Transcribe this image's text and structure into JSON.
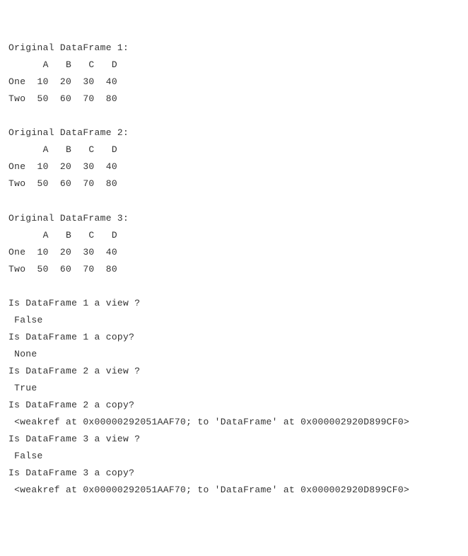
{
  "sections": [
    {
      "title": "Original DataFrame 1:",
      "header": "      A   B   C   D",
      "rows": [
        "One  10  20  30  40",
        "Two  50  60  70  80"
      ]
    },
    {
      "title": "Original DataFrame 2:",
      "header": "      A   B   C   D",
      "rows": [
        "One  10  20  30  40",
        "Two  50  60  70  80"
      ]
    },
    {
      "title": "Original DataFrame 3:",
      "header": "      A   B   C   D",
      "rows": [
        "One  10  20  30  40",
        "Two  50  60  70  80"
      ]
    }
  ],
  "qa": [
    {
      "q": "Is DataFrame 1 a view ?",
      "a": " False"
    },
    {
      "q": "Is DataFrame 1 a copy?",
      "a": " None"
    },
    {
      "q": "Is DataFrame 2 a view ?",
      "a": " True"
    },
    {
      "q": "Is DataFrame 2 a copy?",
      "a": " <weakref at 0x00000292051AAF70; to 'DataFrame' at 0x000002920D899CF0>"
    },
    {
      "q": "Is DataFrame 3 a view ?",
      "a": " False"
    },
    {
      "q": "Is DataFrame 3 a copy?",
      "a": " <weakref at 0x00000292051AAF70; to 'DataFrame' at 0x000002920D899CF0>"
    }
  ]
}
